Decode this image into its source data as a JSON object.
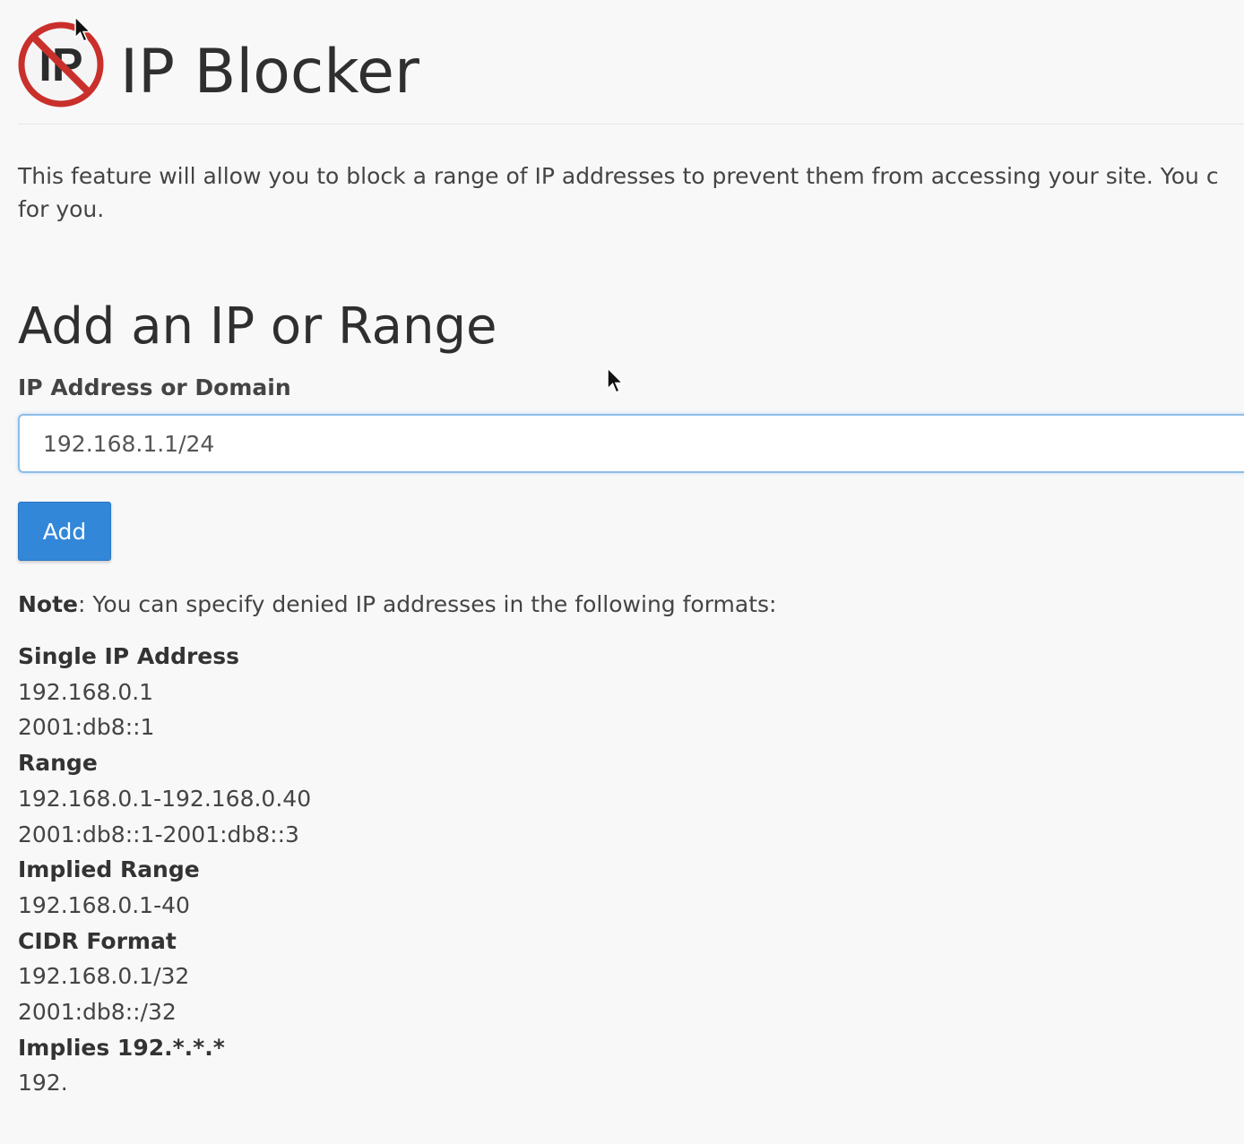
{
  "header": {
    "title": "IP Blocker",
    "logo_icon": "no-ip-icon"
  },
  "description": "This feature will allow you to block a range of IP addresses to prevent them from accessing your site. You c",
  "description_line2": "for you.",
  "add_section": {
    "title": "Add an IP or Range",
    "field_label": "IP Address or Domain",
    "input_value": "192.168.1.1/24",
    "add_button": "Add"
  },
  "note": {
    "label": "Note",
    "text": ": You can specify denied IP addresses in the following formats:"
  },
  "formats": {
    "single": {
      "title": "Single IP Address",
      "examples": [
        "192.168.0.1",
        "2001:db8::1"
      ]
    },
    "range": {
      "title": "Range",
      "examples": [
        "192.168.0.1-192.168.0.40",
        "2001:db8::1-2001:db8::3"
      ]
    },
    "implied": {
      "title": "Implied Range",
      "examples": [
        "192.168.0.1-40"
      ]
    },
    "cidr": {
      "title": "CIDR Format",
      "examples": [
        "192.168.0.1/32",
        "2001:db8::/32"
      ]
    },
    "wildcard": {
      "title": "Implies 192.*.*.*",
      "examples": [
        "192."
      ]
    }
  },
  "colors": {
    "accent": "#3287d9",
    "logo_red": "#c9302c",
    "background": "#f8f8f9"
  }
}
